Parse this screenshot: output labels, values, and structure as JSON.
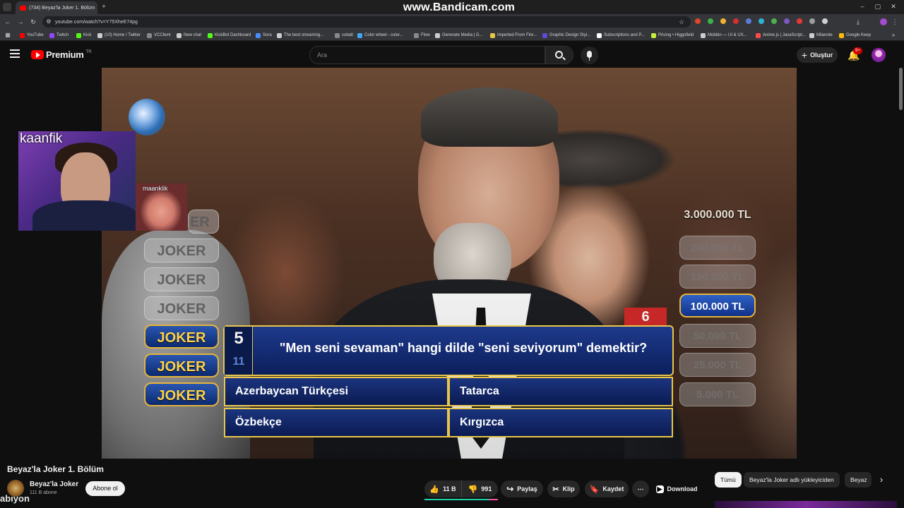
{
  "browser": {
    "tab_title": "(734) Beyaz'la Joker 1. Bölüm",
    "url": "youtube.com/watch?v=Y75XheE74pg",
    "watermark": "www.Bandicam.com",
    "bookmarks": [
      {
        "label": "YouTube",
        "color": "#ff0000"
      },
      {
        "label": "Twitch",
        "color": "#9146ff"
      },
      {
        "label": "Kick",
        "color": "#53fc18"
      },
      {
        "label": "(10) Home / Twitter",
        "color": "#cccccc"
      },
      {
        "label": "VCClient",
        "color": "#888888"
      },
      {
        "label": "New chat",
        "color": "#cccccc"
      },
      {
        "label": "KickBot Dashboard",
        "color": "#53fc18"
      },
      {
        "label": "Sora",
        "color": "#4a8cff"
      },
      {
        "label": "The best streaming...",
        "color": "#cccccc"
      },
      {
        "label": "cobalt",
        "color": "#888888"
      },
      {
        "label": "Color wheel - color...",
        "color": "#3fa9f5"
      },
      {
        "label": "Flow",
        "color": "#888888"
      },
      {
        "label": "Generate Media | G...",
        "color": "#cccccc"
      },
      {
        "label": "Imported From Fire...",
        "color": "#e8c84a"
      },
      {
        "label": "Graphic Design Styl...",
        "color": "#5b4bd6"
      },
      {
        "label": "Subscriptions and P...",
        "color": "#ffffff"
      },
      {
        "label": "Pricing • Higgsfield",
        "color": "#c5f03b"
      },
      {
        "label": "Mobbin — UI & UX...",
        "color": "#cccccc"
      },
      {
        "label": "Anime.js | JavaScript...",
        "color": "#ff4b4b"
      },
      {
        "label": "Milanote",
        "color": "#cccccc"
      },
      {
        "label": "Google Keep",
        "color": "#fbbc04"
      }
    ]
  },
  "youtube": {
    "logo_text": "Premium",
    "region": "TR",
    "search_placeholder": "Ara",
    "create_label": "Oluştur",
    "notif_badge": "9+"
  },
  "video": {
    "overlay_cam1_name": "kaanfik",
    "overlay_cam2_name": "maanklik",
    "joker_label": "JOKER",
    "joker_partial": "ER",
    "prize_top": "3.000.000 TL",
    "prize_current": "100.000 TL",
    "prize_dim": [
      "200.000 TL",
      "150.000 TL",
      "50.000 TL",
      "25.000 TL",
      "5.000 TL"
    ],
    "question_tag": "6",
    "question_current": "5",
    "question_total": "11",
    "question_text": "\"Men seni sevaman\" hangi dilde \"seni seviyorum\" demektir?",
    "answers": [
      "Azerbaycan Türkçesi",
      "Tatarca",
      "Özbekçe",
      "Kırgızca"
    ]
  },
  "below": {
    "title": "Beyaz'la Joker 1. Bölüm",
    "channel": "Beyaz'la Joker",
    "subs": "111 B abone",
    "subscribe": "Abone ol",
    "likes": "11 B",
    "dislikes": "991",
    "share": "Paylaş",
    "clip": "Klip",
    "save": "Kaydet",
    "download": "Download",
    "chips": [
      "Tümü",
      "Beyaz'la Joker adlı yükleyiciden",
      "Beyaz"
    ],
    "stray_text": "abıyon"
  }
}
